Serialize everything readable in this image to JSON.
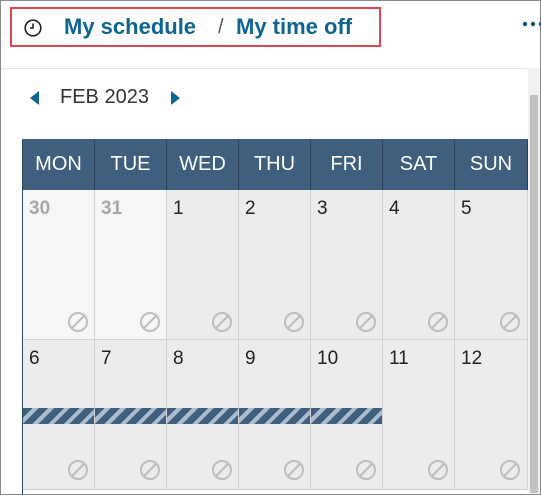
{
  "breadcrumb": {
    "icon": "clock-icon",
    "item1": "My schedule",
    "separator": "/",
    "item2": "My time off"
  },
  "header": {
    "more_icon": "more-horizontal-icon"
  },
  "calendar": {
    "month_label": "FEB 2023",
    "weekdays": [
      "MON",
      "TUE",
      "WED",
      "THU",
      "FRI",
      "SAT",
      "SUN"
    ],
    "weeks": [
      [
        {
          "day": "30",
          "other_month": true
        },
        {
          "day": "31",
          "other_month": true
        },
        {
          "day": "1"
        },
        {
          "day": "2"
        },
        {
          "day": "3"
        },
        {
          "day": "4"
        },
        {
          "day": "5"
        }
      ],
      [
        {
          "day": "6",
          "time_off": true
        },
        {
          "day": "7",
          "time_off": true
        },
        {
          "day": "8",
          "time_off": true
        },
        {
          "day": "9",
          "time_off": true
        },
        {
          "day": "10",
          "time_off": true
        },
        {
          "day": "11"
        },
        {
          "day": "12"
        }
      ]
    ],
    "unavailable_icon": "not-available-icon",
    "colors": {
      "header_bg": "#3f5f7f",
      "link": "#0e6493",
      "time_off_stripe": "#3f5f7f",
      "highlight_border": "#e0464e"
    }
  }
}
